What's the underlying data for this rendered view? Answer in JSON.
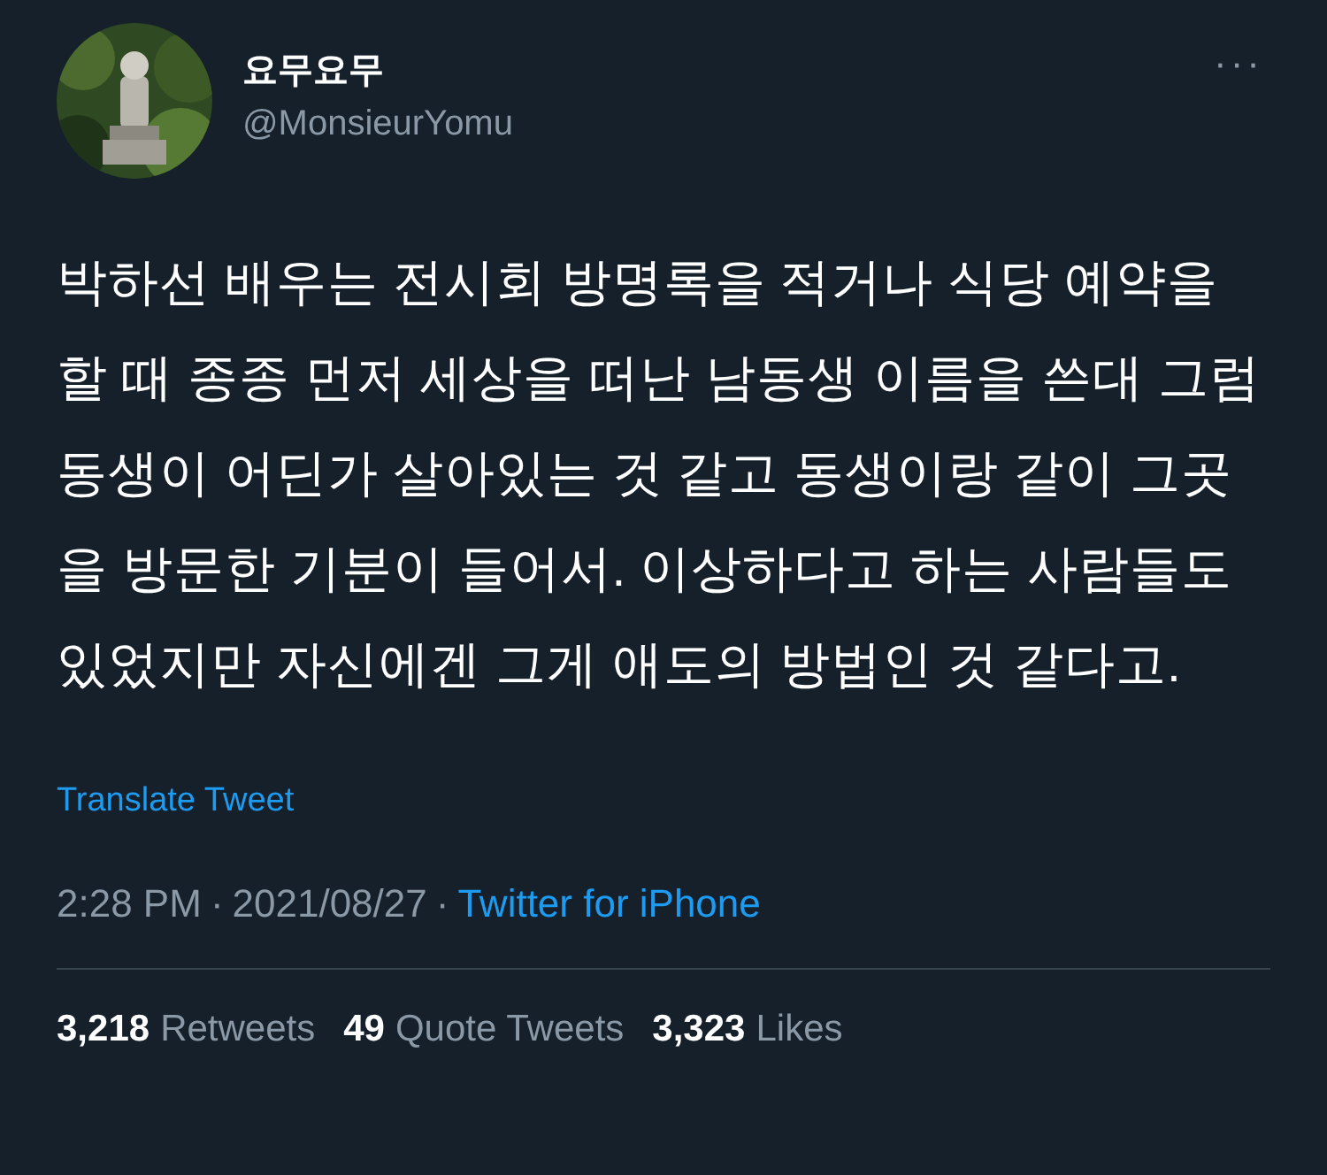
{
  "author": {
    "name": "요무요무",
    "handle": "@MonsieurYomu"
  },
  "more": "···",
  "body": "박하선 배우는 전시회 방명록을 적거나 식당 예약을 할 때 종종 먼저 세상을 떠난 남동생 이름을 쓴대 그럼 동생이 어딘가 살아있는 것 같고 동생이랑 같이 그곳을 방문한 기분이 들어서. 이상하다고 하는 사람들도 있었지만 자신에겐 그게 애도의 방법인 것 같다고.",
  "translate": "Translate Tweet",
  "meta": {
    "time": "2:28 PM",
    "separator": "·",
    "date": "2021/08/27",
    "source": "Twitter for iPhone"
  },
  "stats": [
    {
      "count": "3,218",
      "label": "Retweets"
    },
    {
      "count": "49",
      "label": "Quote Tweets"
    },
    {
      "count": "3,323",
      "label": "Likes"
    }
  ]
}
